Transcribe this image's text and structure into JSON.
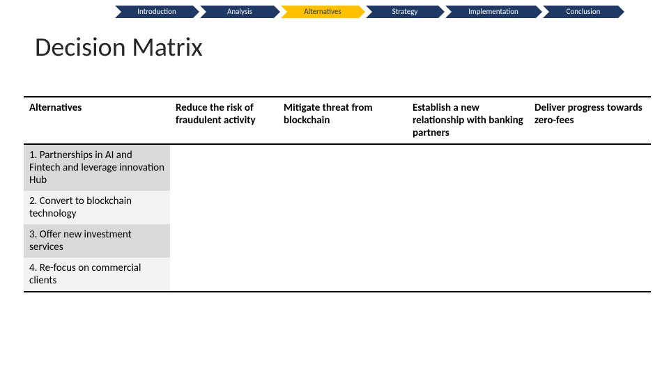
{
  "nav": {
    "items": [
      {
        "label": "Introduction",
        "active": false
      },
      {
        "label": "Analysis",
        "active": false
      },
      {
        "label": "Alternatives",
        "active": true
      },
      {
        "label": "Strategy",
        "active": false
      },
      {
        "label": "Implementation",
        "active": false
      },
      {
        "label": "Conclusion",
        "active": false
      }
    ]
  },
  "title": "Decision Matrix",
  "matrix": {
    "header": {
      "rowTitle": "Alternatives",
      "criteria": [
        "Reduce the risk of fraudulent activity",
        "Mitigate threat from blockchain",
        "Establish a new relationship with banking partners",
        "Deliver progress towards zero-fees"
      ]
    },
    "rows": [
      {
        "name": "1. Partnerships in AI and Fintech and leverage innovation Hub",
        "cells": [
          "",
          "",
          "",
          ""
        ]
      },
      {
        "name": "2. Convert to blockchain technology",
        "cells": [
          "",
          "",
          "",
          ""
        ]
      },
      {
        "name": "3. Offer new investment services",
        "cells": [
          "",
          "",
          "",
          ""
        ]
      },
      {
        "name": "4. Re-focus on commercial clients",
        "cells": [
          "",
          "",
          "",
          ""
        ]
      }
    ]
  }
}
